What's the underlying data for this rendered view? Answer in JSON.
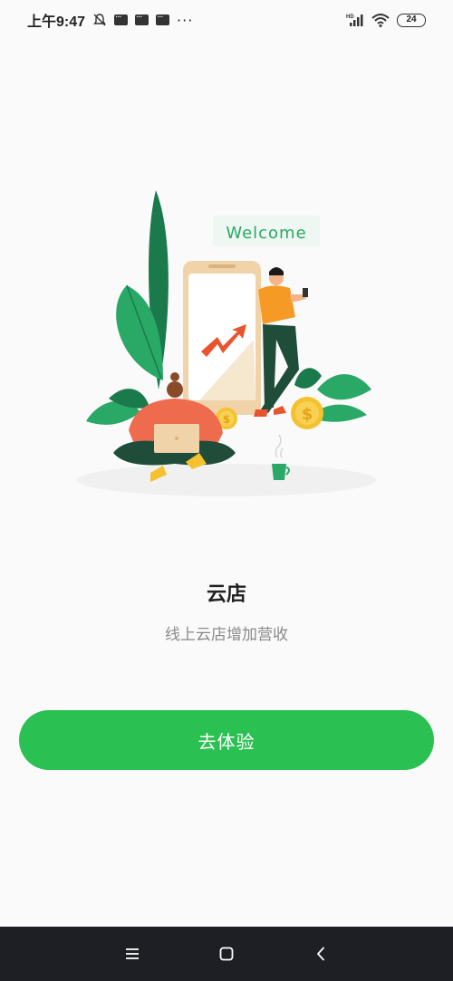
{
  "status_bar": {
    "time": "上午9:47",
    "battery": "24",
    "network_label": "HD",
    "icons": [
      "muted-bell-icon",
      "message-icon",
      "message-icon",
      "message-icon",
      "more-dots-icon",
      "signal-icon",
      "wifi-icon",
      "battery-icon"
    ]
  },
  "illustration": {
    "welcome_text": "Welcome",
    "coin_symbol": "$"
  },
  "main": {
    "title": "云店",
    "subtitle": "线上云店增加营收",
    "cta_label": "去体验"
  },
  "colors": {
    "accent": "#2bc152",
    "leaf_dark": "#1a7a4c",
    "leaf_light": "#2aa865",
    "person_orange": "#f08a3c",
    "coin": "#f5c12e",
    "nav_bg": "#1e1f24"
  },
  "nav_bar": {
    "icons": [
      "menu-icon",
      "home-square-icon",
      "back-chevron-icon"
    ]
  }
}
